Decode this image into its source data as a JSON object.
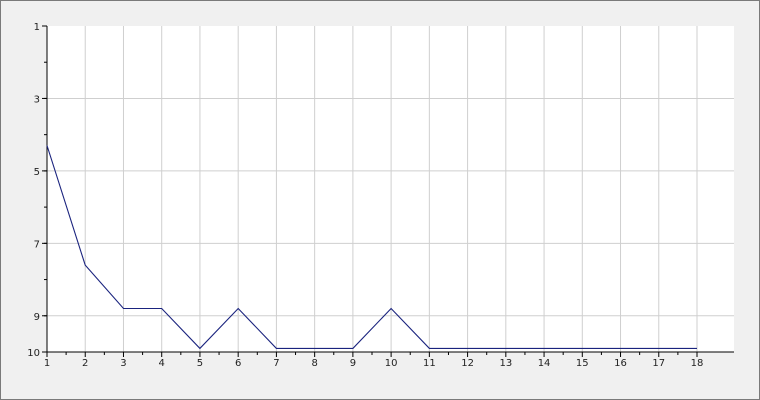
{
  "chart_data": {
    "type": "line",
    "title": "",
    "xlabel": "",
    "ylabel": "",
    "y_reversed": true,
    "xlim": [
      1,
      18
    ],
    "ylim": [
      1,
      10
    ],
    "x_ticks": [
      "1",
      "2",
      "3",
      "4",
      "5",
      "6",
      "7",
      "8",
      "9",
      "10",
      "11",
      "12",
      "13",
      "14",
      "15",
      "16",
      "17",
      "18"
    ],
    "y_ticks": [
      "1",
      "3",
      "5",
      "7",
      "9",
      "10"
    ],
    "grid": true,
    "colors": {
      "line": "#1a237e",
      "grid": "#cfcfcf",
      "plot_bg": "#ffffff",
      "axis": "#000000"
    },
    "series": [
      {
        "x": [
          1,
          2,
          3,
          4,
          5,
          6,
          7,
          8,
          9,
          10,
          11,
          12,
          13,
          14,
          15,
          16,
          17,
          18
        ],
        "y": [
          4.3,
          7.6,
          8.8,
          8.8,
          9.9,
          8.8,
          9.9,
          9.9,
          9.9,
          8.8,
          9.9,
          9.9,
          9.9,
          9.9,
          9.9,
          9.9,
          9.9,
          9.9
        ]
      }
    ]
  }
}
